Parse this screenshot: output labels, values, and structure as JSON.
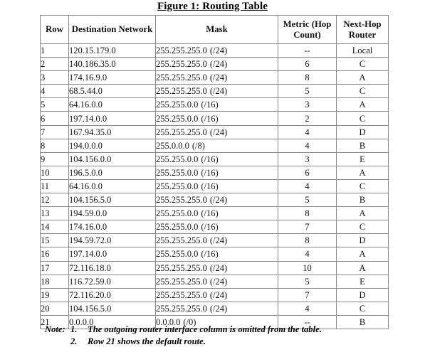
{
  "figure": {
    "title": "Figure 1: Routing Table"
  },
  "table": {
    "headers": [
      "Row",
      "Destination Network",
      "Mask",
      "Metric (Hop Count)",
      "Next-Hop Router"
    ],
    "rows": [
      {
        "row": "1",
        "destination": "120.15.179.0",
        "mask": "255.255.255.0",
        "prefix": "(/24)",
        "metric": "--",
        "next_hop": "Local"
      },
      {
        "row": "2",
        "destination": "140.186.35.0",
        "mask": "255.255.255.0",
        "prefix": "(/24)",
        "metric": "6",
        "next_hop": "C"
      },
      {
        "row": "3",
        "destination": "174.16.9.0",
        "mask": "255.255.255.0",
        "prefix": "(/24)",
        "metric": "8",
        "next_hop": "A"
      },
      {
        "row": "4",
        "destination": "68.5.44.0",
        "mask": "255.255.255.0",
        "prefix": "(/24)",
        "metric": "5",
        "next_hop": "C"
      },
      {
        "row": "5",
        "destination": "64.16.0.0",
        "mask": "255.255.0.0",
        "prefix": "(/16)",
        "metric": "3",
        "next_hop": "A"
      },
      {
        "row": "6",
        "destination": "197.14.0.0",
        "mask": "255.255.0.0",
        "prefix": "(/16)",
        "metric": "2",
        "next_hop": "C"
      },
      {
        "row": "7",
        "destination": "167.94.35.0",
        "mask": "255.255.255.0",
        "prefix": "(/24)",
        "metric": "4",
        "next_hop": "D"
      },
      {
        "row": "8",
        "destination": "194.0.0.0",
        "mask": "255.0.0.0",
        "prefix": "(/8)",
        "metric": "4",
        "next_hop": "B"
      },
      {
        "row": "9",
        "destination": "104.156.0.0",
        "mask": "255.255.0.0",
        "prefix": "(/16)",
        "metric": "3",
        "next_hop": "E"
      },
      {
        "row": "10",
        "destination": "196.5.0.0",
        "mask": "255.255.0.0",
        "prefix": "(/16)",
        "metric": "6",
        "next_hop": "A"
      },
      {
        "row": "11",
        "destination": "64.16.0.0",
        "mask": "255.255.0.0",
        "prefix": "(/16)",
        "metric": "4",
        "next_hop": "C"
      },
      {
        "row": "12",
        "destination": "104.156.5.0",
        "mask": "255.255.255.0",
        "prefix": "(/24)",
        "metric": "5",
        "next_hop": "B"
      },
      {
        "row": "13",
        "destination": "194.59.0.0",
        "mask": "255.255.0.0",
        "prefix": "(/16)",
        "metric": "8",
        "next_hop": "A"
      },
      {
        "row": "14",
        "destination": "174.16.0.0",
        "mask": "255.255.0.0",
        "prefix": "(/16)",
        "metric": "7",
        "next_hop": "C"
      },
      {
        "row": "15",
        "destination": "194.59.72.0",
        "mask": "255.255.255.0",
        "prefix": "(/24)",
        "metric": "8",
        "next_hop": "D"
      },
      {
        "row": "16",
        "destination": "197.14.0.0",
        "mask": "255.255.0.0",
        "prefix": "(/16)",
        "metric": "4",
        "next_hop": "A"
      },
      {
        "row": "17",
        "destination": "72.116.18.0",
        "mask": "255.255.255.0",
        "prefix": "(/24)",
        "metric": "10",
        "next_hop": "A"
      },
      {
        "row": "18",
        "destination": "116.72.59.0",
        "mask": "255.255.255.0",
        "prefix": "(/24)",
        "metric": "5",
        "next_hop": "E"
      },
      {
        "row": "19",
        "destination": "72.116.20.0",
        "mask": "255.255.255.0",
        "prefix": "(/24)",
        "metric": "7",
        "next_hop": "D"
      },
      {
        "row": "20",
        "destination": "104.156.5.0",
        "mask": "255.255.255.0",
        "prefix": "(/24)",
        "metric": "4",
        "next_hop": "C"
      },
      {
        "row": "21",
        "destination": "0.0.0.0",
        "mask": "0.0.0.0",
        "prefix": "(/0)",
        "metric": "--",
        "next_hop": "B"
      }
    ]
  },
  "notes": {
    "label": "Note:",
    "items": [
      {
        "number": "1.",
        "text": "The outgoing router interface column is omitted from the table."
      },
      {
        "number": "2.",
        "text": "Row 21 shows the default route."
      }
    ]
  }
}
